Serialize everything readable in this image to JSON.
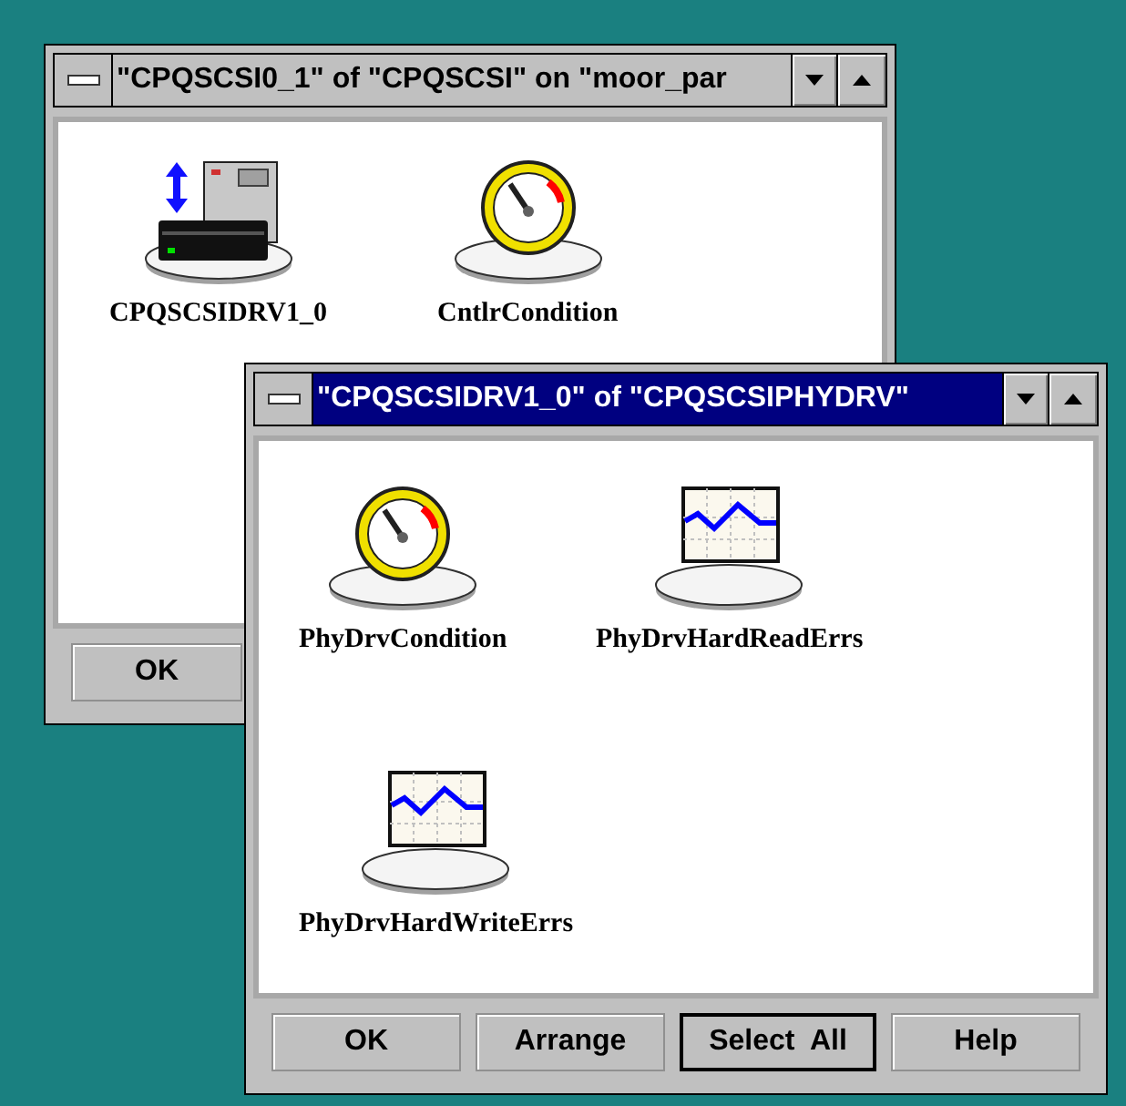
{
  "windows": [
    {
      "title": "\"CPQSCSI0_1\" of \"CPQSCSI\" on \"moor_par",
      "active": false,
      "items": [
        {
          "label": "CPQSCSIDRV1_0",
          "kind": "server"
        },
        {
          "label": "CntlrCondition",
          "kind": "gauge"
        }
      ],
      "buttons": [
        {
          "label": "OK",
          "default": false
        }
      ]
    },
    {
      "title": "\"CPQSCSIDRV1_0\" of \"CPQSCSIPHYDRV\"",
      "active": true,
      "items": [
        {
          "label": "PhyDrvCondition",
          "kind": "gauge"
        },
        {
          "label": "PhyDrvHardReadErrs",
          "kind": "chart"
        },
        {
          "label": "PhyDrvHardWriteErrs",
          "kind": "chart"
        }
      ],
      "buttons": [
        {
          "label": "OK",
          "default": false
        },
        {
          "label": "Arrange",
          "default": false
        },
        {
          "label": "Select  All",
          "default": true
        },
        {
          "label": "Help",
          "default": false
        }
      ]
    }
  ]
}
